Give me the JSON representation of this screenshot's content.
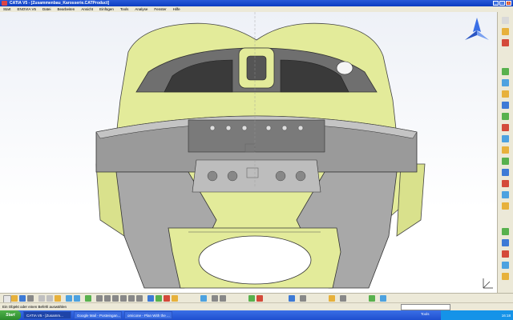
{
  "window": {
    "title": "CATIA V5 - [Zusammenbau_Karosserie.CATProduct]"
  },
  "menu": {
    "items": [
      "Start",
      "ENOVIA V5",
      "Datei",
      "Bearbeiten",
      "Ansicht",
      "Einfügen",
      "Tools",
      "Analyse",
      "Fenster",
      "Hilfe"
    ]
  },
  "status": {
    "message": "Ein Objekt oder einen Befehl auswählen"
  },
  "taskbar": {
    "start_label": "Start",
    "tasks": [
      {
        "label": "CATIA V5 - [Zusamm..."
      },
      {
        "label": "Google Mail - Posteingan..."
      },
      {
        "label": "omicone - Plan With the ..."
      }
    ],
    "language": "Tools",
    "clock": "16:18"
  },
  "colors": {
    "accent": "#0b3cc1",
    "part_yellow": "#e3eb9a",
    "part_gray": "#8a8a8a"
  }
}
